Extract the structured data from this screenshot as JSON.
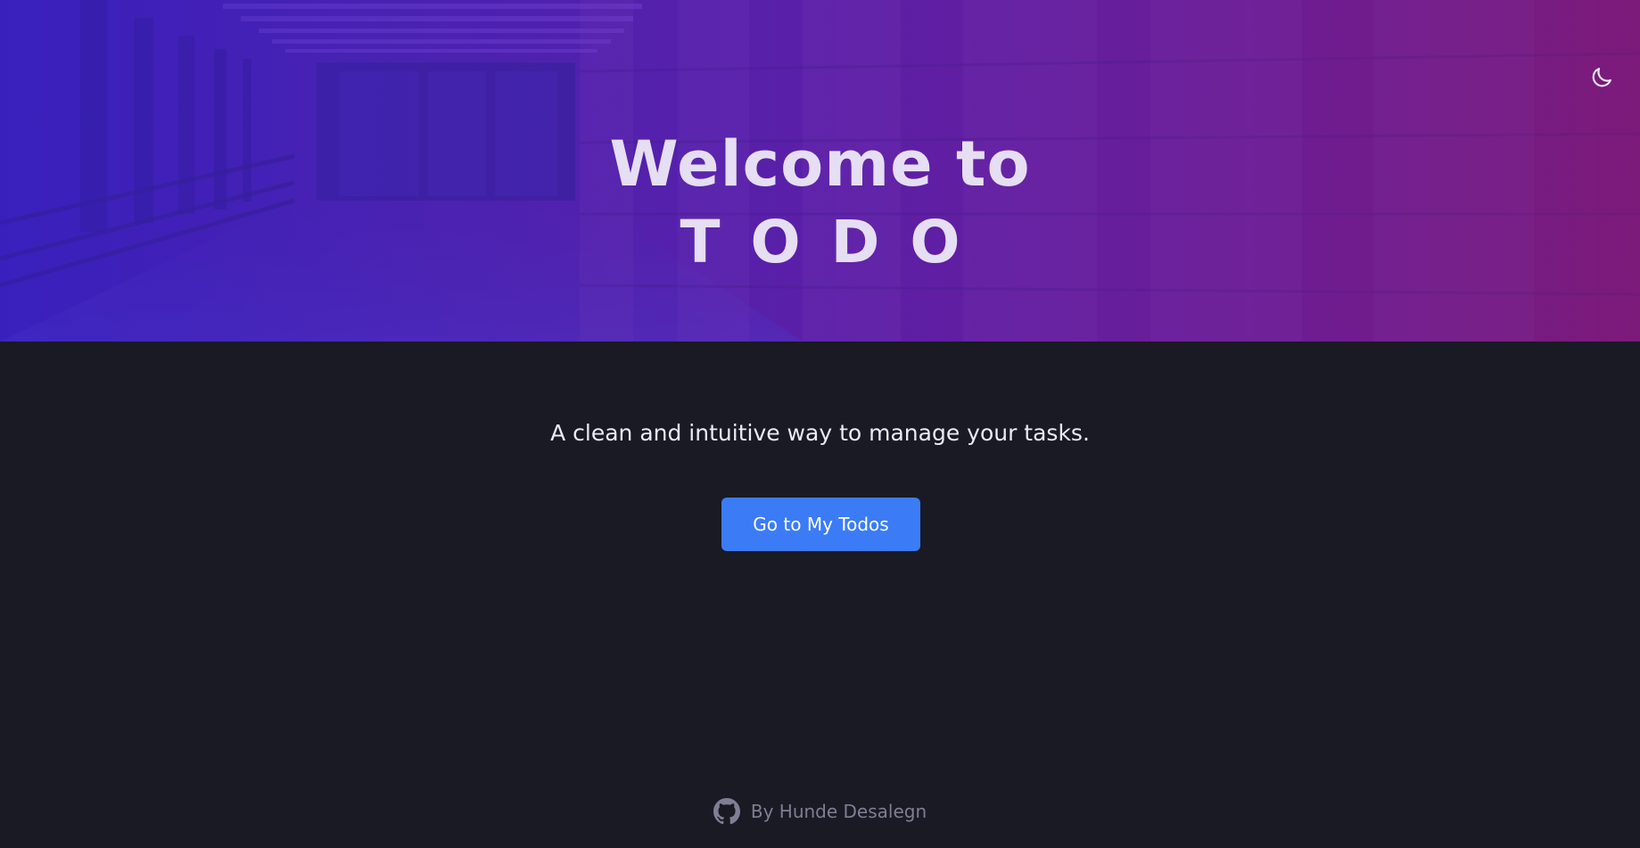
{
  "hero": {
    "title_line1": "Welcome to",
    "title_line2": "TODO",
    "background_image": "corridor-photo",
    "gradient_colors": [
      "#3a20b8",
      "#5a1fa8",
      "#7b1a7c"
    ]
  },
  "header": {
    "theme_toggle_icon": "moon-icon"
  },
  "main": {
    "tagline": "A clean and intuitive way to manage your tasks.",
    "cta_label": "Go to My Todos"
  },
  "footer": {
    "icon": "github-icon",
    "credit": "By Hunde Desalegn"
  },
  "colors": {
    "background": "#191a23",
    "accent": "#3b7cf6",
    "hero_text": "#e6def3",
    "footer_text": "#7e7f94"
  }
}
